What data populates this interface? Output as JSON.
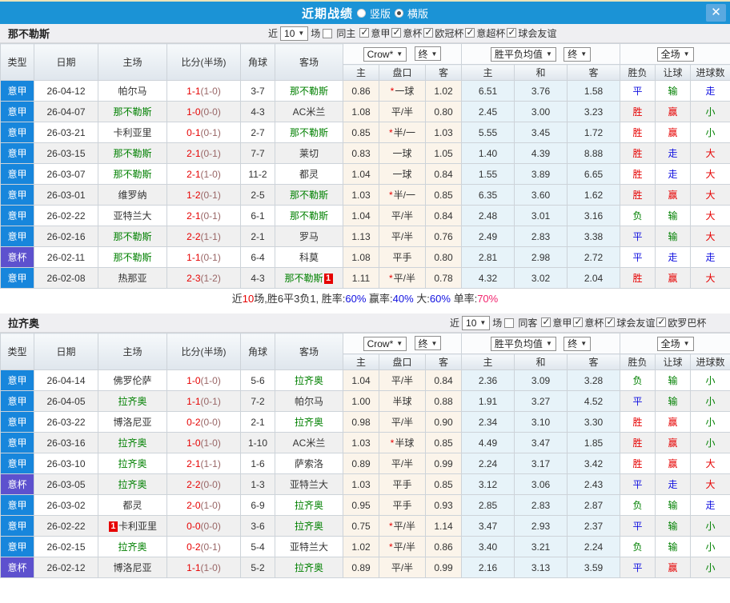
{
  "titlebar": {
    "title": "近期战绩",
    "radios": [
      {
        "label": "竖版",
        "selected": false
      },
      {
        "label": "横版",
        "selected": true
      }
    ],
    "selected_mode": "横版",
    "close_glyph": "✕"
  },
  "columns": {
    "main": [
      "类型",
      "日期",
      "主场",
      "比分(半场)",
      "角球",
      "客场"
    ],
    "sub": [
      "主",
      "盘口",
      "客",
      "主",
      "和",
      "客",
      "胜负",
      "让球",
      "进球数"
    ]
  },
  "dropdowns": {
    "bookmaker": "Crow*",
    "final": "终",
    "avg": "胜平负均值",
    "final2": "终",
    "scope": "全场"
  },
  "result_color_map": {
    "胜": "red",
    "平": "blue",
    "负": "green",
    "赢": "red",
    "走": "blue",
    "输": "green",
    "大": "red",
    "小": "green"
  },
  "colors": {
    "titlebar_bg": "#1B93D6",
    "league_cell_bg": "#1786DC",
    "cup_cell_bg": "#5D51CE",
    "team_highlight_green": "#008000",
    "score_red": "#E60000",
    "half_score_muted": "#996666",
    "result_red": "#E60000",
    "result_blue": "#1010E0",
    "result_green": "#008000",
    "summary_pct_blue": "#1010E0",
    "summary_pct_pink": "#F2246E",
    "crow_column_bg": "#FBF4EA",
    "avg_column_bg": "#E7F3F9"
  },
  "sections": [
    {
      "team": "那不勒斯",
      "filter": {
        "near_label": "近",
        "count": "10",
        "games_label": "场",
        "same_venue_label": "同主",
        "same_venue_checked": false,
        "leagues": [
          {
            "label": "意甲",
            "checked": true
          },
          {
            "label": "意杯",
            "checked": true
          },
          {
            "label": "欧冠杯",
            "checked": true
          },
          {
            "label": "意超杯",
            "checked": true
          },
          {
            "label": "球会友谊",
            "checked": true
          }
        ]
      },
      "rows": [
        {
          "league": "意甲",
          "type": "league",
          "date": "26-04-12",
          "home": "帕尔马",
          "home_green": false,
          "home_badge": null,
          "score": "1-1",
          "half": "(1-0)",
          "corner": "3-7",
          "away": "那不勒斯",
          "away_green": true,
          "away_badge": null,
          "odds": {
            "home": "0.86",
            "star": true,
            "handicap": "一球",
            "away": "1.02"
          },
          "avg": {
            "home": "6.51",
            "draw": "3.76",
            "away": "1.58"
          },
          "result": "平",
          "handicap_result": "输",
          "goals_result": "走"
        },
        {
          "league": "意甲",
          "type": "league",
          "date": "26-04-07",
          "home": "那不勒斯",
          "home_green": true,
          "home_badge": null,
          "score": "1-0",
          "half": "(0-0)",
          "corner": "4-3",
          "away": "AC米兰",
          "away_green": false,
          "away_badge": null,
          "odds": {
            "home": "1.08",
            "star": false,
            "handicap": "平/半",
            "away": "0.80"
          },
          "avg": {
            "home": "2.45",
            "draw": "3.00",
            "away": "3.23"
          },
          "result": "胜",
          "handicap_result": "赢",
          "goals_result": "小"
        },
        {
          "league": "意甲",
          "type": "league",
          "date": "26-03-21",
          "home": "卡利亚里",
          "home_green": false,
          "home_badge": null,
          "score": "0-1",
          "half": "(0-1)",
          "corner": "2-7",
          "away": "那不勒斯",
          "away_green": true,
          "away_badge": null,
          "odds": {
            "home": "0.85",
            "star": true,
            "handicap": "半/一",
            "away": "1.03"
          },
          "avg": {
            "home": "5.55",
            "draw": "3.45",
            "away": "1.72"
          },
          "result": "胜",
          "handicap_result": "赢",
          "goals_result": "小"
        },
        {
          "league": "意甲",
          "type": "league",
          "date": "26-03-15",
          "home": "那不勒斯",
          "home_green": true,
          "home_badge": null,
          "score": "2-1",
          "half": "(0-1)",
          "corner": "7-7",
          "away": "莱切",
          "away_green": false,
          "away_badge": null,
          "odds": {
            "home": "0.83",
            "star": false,
            "handicap": "一球",
            "away": "1.05"
          },
          "avg": {
            "home": "1.40",
            "draw": "4.39",
            "away": "8.88"
          },
          "result": "胜",
          "handicap_result": "走",
          "goals_result": "大"
        },
        {
          "league": "意甲",
          "type": "league",
          "date": "26-03-07",
          "home": "那不勒斯",
          "home_green": true,
          "home_badge": null,
          "score": "2-1",
          "half": "(1-0)",
          "corner": "11-2",
          "away": "都灵",
          "away_green": false,
          "away_badge": null,
          "odds": {
            "home": "1.04",
            "star": false,
            "handicap": "一球",
            "away": "0.84"
          },
          "avg": {
            "home": "1.55",
            "draw": "3.89",
            "away": "6.65"
          },
          "result": "胜",
          "handicap_result": "走",
          "goals_result": "大"
        },
        {
          "league": "意甲",
          "type": "league",
          "date": "26-03-01",
          "home": "维罗纳",
          "home_green": false,
          "home_badge": null,
          "score": "1-2",
          "half": "(0-1)",
          "corner": "2-5",
          "away": "那不勒斯",
          "away_green": true,
          "away_badge": null,
          "odds": {
            "home": "1.03",
            "star": true,
            "handicap": "半/一",
            "away": "0.85"
          },
          "avg": {
            "home": "6.35",
            "draw": "3.60",
            "away": "1.62"
          },
          "result": "胜",
          "handicap_result": "赢",
          "goals_result": "大"
        },
        {
          "league": "意甲",
          "type": "league",
          "date": "26-02-22",
          "home": "亚特兰大",
          "home_green": false,
          "home_badge": null,
          "score": "2-1",
          "half": "(0-1)",
          "corner": "6-1",
          "away": "那不勒斯",
          "away_green": true,
          "away_badge": null,
          "odds": {
            "home": "1.04",
            "star": false,
            "handicap": "平/半",
            "away": "0.84"
          },
          "avg": {
            "home": "2.48",
            "draw": "3.01",
            "away": "3.16"
          },
          "result": "负",
          "handicap_result": "输",
          "goals_result": "大"
        },
        {
          "league": "意甲",
          "type": "league",
          "date": "26-02-16",
          "home": "那不勒斯",
          "home_green": true,
          "home_badge": null,
          "score": "2-2",
          "half": "(1-1)",
          "corner": "2-1",
          "away": "罗马",
          "away_green": false,
          "away_badge": null,
          "odds": {
            "home": "1.13",
            "star": false,
            "handicap": "平/半",
            "away": "0.76"
          },
          "avg": {
            "home": "2.49",
            "draw": "2.83",
            "away": "3.38"
          },
          "result": "平",
          "handicap_result": "输",
          "goals_result": "大"
        },
        {
          "league": "意杯",
          "type": "cup",
          "date": "26-02-11",
          "home": "那不勒斯",
          "home_green": true,
          "home_badge": null,
          "score": "1-1",
          "half": "(0-1)",
          "corner": "6-4",
          "away": "科莫",
          "away_green": false,
          "away_badge": null,
          "odds": {
            "home": "1.08",
            "star": false,
            "handicap": "平手",
            "away": "0.80"
          },
          "avg": {
            "home": "2.81",
            "draw": "2.98",
            "away": "2.72"
          },
          "result": "平",
          "handicap_result": "走",
          "goals_result": "走"
        },
        {
          "league": "意甲",
          "type": "league",
          "date": "26-02-08",
          "home": "热那亚",
          "home_green": false,
          "home_badge": null,
          "score": "2-3",
          "half": "(1-2)",
          "corner": "4-3",
          "away": "那不勒斯",
          "away_green": true,
          "away_badge": "1",
          "odds": {
            "home": "1.11",
            "star": true,
            "handicap": "平/半",
            "away": "0.78"
          },
          "avg": {
            "home": "4.32",
            "draw": "3.02",
            "away": "2.04"
          },
          "result": "胜",
          "handicap_result": "赢",
          "goals_result": "大"
        }
      ],
      "summary": [
        {
          "t": "近",
          "c": "dark"
        },
        {
          "t": "10",
          "c": "red"
        },
        {
          "t": "场,胜6平3负1, 胜率:",
          "c": "dark"
        },
        {
          "t": "60%",
          "c": "blue"
        },
        {
          "t": " 赢率:",
          "c": "dark"
        },
        {
          "t": "40%",
          "c": "blue"
        },
        {
          "t": " 大:",
          "c": "dark"
        },
        {
          "t": "60%",
          "c": "blue"
        },
        {
          "t": " 单率:",
          "c": "dark"
        },
        {
          "t": "70%",
          "c": "pink"
        }
      ]
    },
    {
      "team": "拉齐奥",
      "filter": {
        "near_label": "近",
        "count": "10",
        "games_label": "场",
        "same_venue_label": "同客",
        "same_venue_checked": false,
        "leagues": [
          {
            "label": "意甲",
            "checked": true
          },
          {
            "label": "意杯",
            "checked": true
          },
          {
            "label": "球会友谊",
            "checked": true
          },
          {
            "label": "欧罗巴杯",
            "checked": true
          }
        ]
      },
      "rows": [
        {
          "league": "意甲",
          "type": "league",
          "date": "26-04-14",
          "home": "佛罗伦萨",
          "home_green": false,
          "home_badge": null,
          "score": "1-0",
          "half": "(1-0)",
          "corner": "5-6",
          "away": "拉齐奥",
          "away_green": true,
          "away_badge": null,
          "odds": {
            "home": "1.04",
            "star": false,
            "handicap": "平/半",
            "away": "0.84"
          },
          "avg": {
            "home": "2.36",
            "draw": "3.09",
            "away": "3.28"
          },
          "result": "负",
          "handicap_result": "输",
          "goals_result": "小"
        },
        {
          "league": "意甲",
          "type": "league",
          "date": "26-04-05",
          "home": "拉齐奥",
          "home_green": true,
          "home_badge": null,
          "score": "1-1",
          "half": "(0-1)",
          "corner": "7-2",
          "away": "帕尔马",
          "away_green": false,
          "away_badge": null,
          "odds": {
            "home": "1.00",
            "star": false,
            "handicap": "半球",
            "away": "0.88"
          },
          "avg": {
            "home": "1.91",
            "draw": "3.27",
            "away": "4.52"
          },
          "result": "平",
          "handicap_result": "输",
          "goals_result": "小"
        },
        {
          "league": "意甲",
          "type": "league",
          "date": "26-03-22",
          "home": "博洛尼亚",
          "home_green": false,
          "home_badge": null,
          "score": "0-2",
          "half": "(0-0)",
          "corner": "2-1",
          "away": "拉齐奥",
          "away_green": true,
          "away_badge": null,
          "odds": {
            "home": "0.98",
            "star": false,
            "handicap": "平/半",
            "away": "0.90"
          },
          "avg": {
            "home": "2.34",
            "draw": "3.10",
            "away": "3.30"
          },
          "result": "胜",
          "handicap_result": "赢",
          "goals_result": "小"
        },
        {
          "league": "意甲",
          "type": "league",
          "date": "26-03-16",
          "home": "拉齐奥",
          "home_green": true,
          "home_badge": null,
          "score": "1-0",
          "half": "(1-0)",
          "corner": "1-10",
          "away": "AC米兰",
          "away_green": false,
          "away_badge": null,
          "odds": {
            "home": "1.03",
            "star": true,
            "handicap": "半球",
            "away": "0.85"
          },
          "avg": {
            "home": "4.49",
            "draw": "3.47",
            "away": "1.85"
          },
          "result": "胜",
          "handicap_result": "赢",
          "goals_result": "小"
        },
        {
          "league": "意甲",
          "type": "league",
          "date": "26-03-10",
          "home": "拉齐奥",
          "home_green": true,
          "home_badge": null,
          "score": "2-1",
          "half": "(1-1)",
          "corner": "1-6",
          "away": "萨索洛",
          "away_green": false,
          "away_badge": null,
          "odds": {
            "home": "0.89",
            "star": false,
            "handicap": "平/半",
            "away": "0.99"
          },
          "avg": {
            "home": "2.24",
            "draw": "3.17",
            "away": "3.42"
          },
          "result": "胜",
          "handicap_result": "赢",
          "goals_result": "大"
        },
        {
          "league": "意杯",
          "type": "cup",
          "date": "26-03-05",
          "home": "拉齐奥",
          "home_green": true,
          "home_badge": null,
          "score": "2-2",
          "half": "(0-0)",
          "corner": "1-3",
          "away": "亚特兰大",
          "away_green": false,
          "away_badge": null,
          "odds": {
            "home": "1.03",
            "star": false,
            "handicap": "平手",
            "away": "0.85"
          },
          "avg": {
            "home": "3.12",
            "draw": "3.06",
            "away": "2.43"
          },
          "result": "平",
          "handicap_result": "走",
          "goals_result": "大"
        },
        {
          "league": "意甲",
          "type": "league",
          "date": "26-03-02",
          "home": "都灵",
          "home_green": false,
          "home_badge": null,
          "score": "2-0",
          "half": "(1-0)",
          "corner": "6-9",
          "away": "拉齐奥",
          "away_green": true,
          "away_badge": null,
          "odds": {
            "home": "0.95",
            "star": false,
            "handicap": "平手",
            "away": "0.93"
          },
          "avg": {
            "home": "2.85",
            "draw": "2.83",
            "away": "2.87"
          },
          "result": "负",
          "handicap_result": "输",
          "goals_result": "走"
        },
        {
          "league": "意甲",
          "type": "league",
          "date": "26-02-22",
          "home": "卡利亚里",
          "home_green": false,
          "home_badge": "1",
          "score": "0-0",
          "half": "(0-0)",
          "corner": "3-6",
          "away": "拉齐奥",
          "away_green": true,
          "away_badge": null,
          "odds": {
            "home": "0.75",
            "star": true,
            "handicap": "平/半",
            "away": "1.14"
          },
          "avg": {
            "home": "3.47",
            "draw": "2.93",
            "away": "2.37"
          },
          "result": "平",
          "handicap_result": "输",
          "goals_result": "小"
        },
        {
          "league": "意甲",
          "type": "league",
          "date": "26-02-15",
          "home": "拉齐奥",
          "home_green": true,
          "home_badge": null,
          "score": "0-2",
          "half": "(0-1)",
          "corner": "5-4",
          "away": "亚特兰大",
          "away_green": false,
          "away_badge": null,
          "odds": {
            "home": "1.02",
            "star": true,
            "handicap": "平/半",
            "away": "0.86"
          },
          "avg": {
            "home": "3.40",
            "draw": "3.21",
            "away": "2.24"
          },
          "result": "负",
          "handicap_result": "输",
          "goals_result": "小"
        },
        {
          "league": "意杯",
          "type": "cup",
          "date": "26-02-12",
          "home": "博洛尼亚",
          "home_green": false,
          "home_badge": null,
          "score": "1-1",
          "half": "(1-0)",
          "corner": "5-2",
          "away": "拉齐奥",
          "away_green": true,
          "away_badge": null,
          "odds": {
            "home": "0.89",
            "star": false,
            "handicap": "平/半",
            "away": "0.99"
          },
          "avg": {
            "home": "2.16",
            "draw": "3.13",
            "away": "3.59"
          },
          "result": "平",
          "handicap_result": "赢",
          "goals_result": "小"
        }
      ],
      "summary": null
    }
  ]
}
